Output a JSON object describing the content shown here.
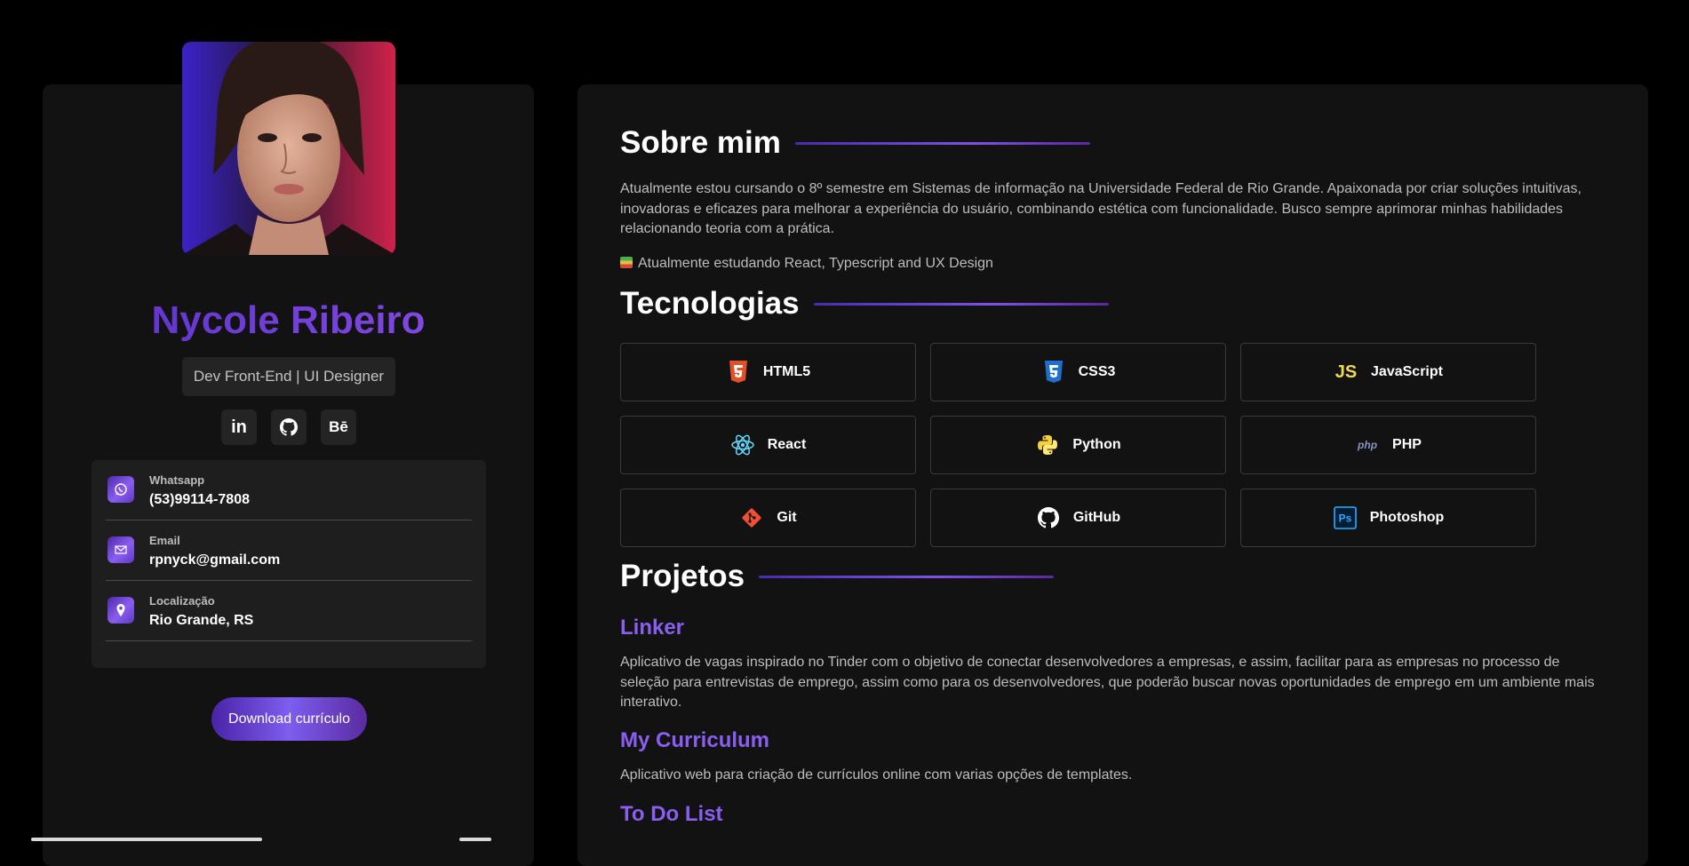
{
  "profile": {
    "name": "Nycole Ribeiro",
    "role": "Dev Front-End | UI Designer",
    "socials": [
      {
        "name": "linkedin",
        "label": "in"
      },
      {
        "name": "github",
        "label": ""
      },
      {
        "name": "behance",
        "label": "Bē"
      }
    ],
    "contacts": [
      {
        "label": "Whatsapp",
        "value": "(53)99114-7808",
        "icon": "whatsapp-icon"
      },
      {
        "label": "Email",
        "value": "rpnyck@gmail.com",
        "icon": "mail-icon"
      },
      {
        "label": "Localização",
        "value": "Rio Grande, RS",
        "icon": "location-icon"
      }
    ],
    "download_label": "Download currículo"
  },
  "about": {
    "title": "Sobre mim",
    "text": "Atualmente estou cursando o 8º semestre em Sistemas de informação na Universidade Federal de Rio Grande. Apaixonada por criar soluções intuitivas, inovadoras e eficazes para melhorar a experiência do usuário, combinando estética com funcionalidade. Busco sempre aprimorar minhas habilidades relacionando teoria com a prática.",
    "studying": "Atualmente estudando React, Typescript and UX Design"
  },
  "technologies": {
    "title": "Tecnologias",
    "items": [
      {
        "label": "HTML5",
        "icon": "html5-icon",
        "color": "#e34f26"
      },
      {
        "label": "CSS3",
        "icon": "css3-icon",
        "color": "#1f6fd0"
      },
      {
        "label": "JavaScript",
        "icon": "javascript-icon",
        "color": "#f0db4f"
      },
      {
        "label": "React",
        "icon": "react-icon",
        "color": "#61dafb"
      },
      {
        "label": "Python",
        "icon": "python-icon",
        "color": "#ffd43b"
      },
      {
        "label": "PHP",
        "icon": "php-icon",
        "color": "#8892bf"
      },
      {
        "label": "Git",
        "icon": "git-icon",
        "color": "#f05032"
      },
      {
        "label": "GitHub",
        "icon": "github-icon",
        "color": "#ffffff"
      },
      {
        "label": "Photoshop",
        "icon": "photoshop-icon",
        "color": "#31a8ff"
      }
    ]
  },
  "projects": {
    "title": "Projetos",
    "items": [
      {
        "name": "Linker",
        "description": "Aplicativo de vagas inspirado no Tinder com o objetivo de conectar desenvolvedores a empresas, e assim, facilitar para as empresas no processo de seleção para entrevistas de emprego, assim como para os desenvolvedores, que poderão buscar novas oportunidades de emprego em um ambiente mais interativo."
      },
      {
        "name": "My Curriculum",
        "description": "Aplicativo web para criação de currículos online com varias opções de templates."
      },
      {
        "name": "To Do List",
        "description": ""
      }
    ]
  },
  "colors": {
    "accent": "#8a5ef0",
    "background": "#000000",
    "card": "#121212"
  }
}
